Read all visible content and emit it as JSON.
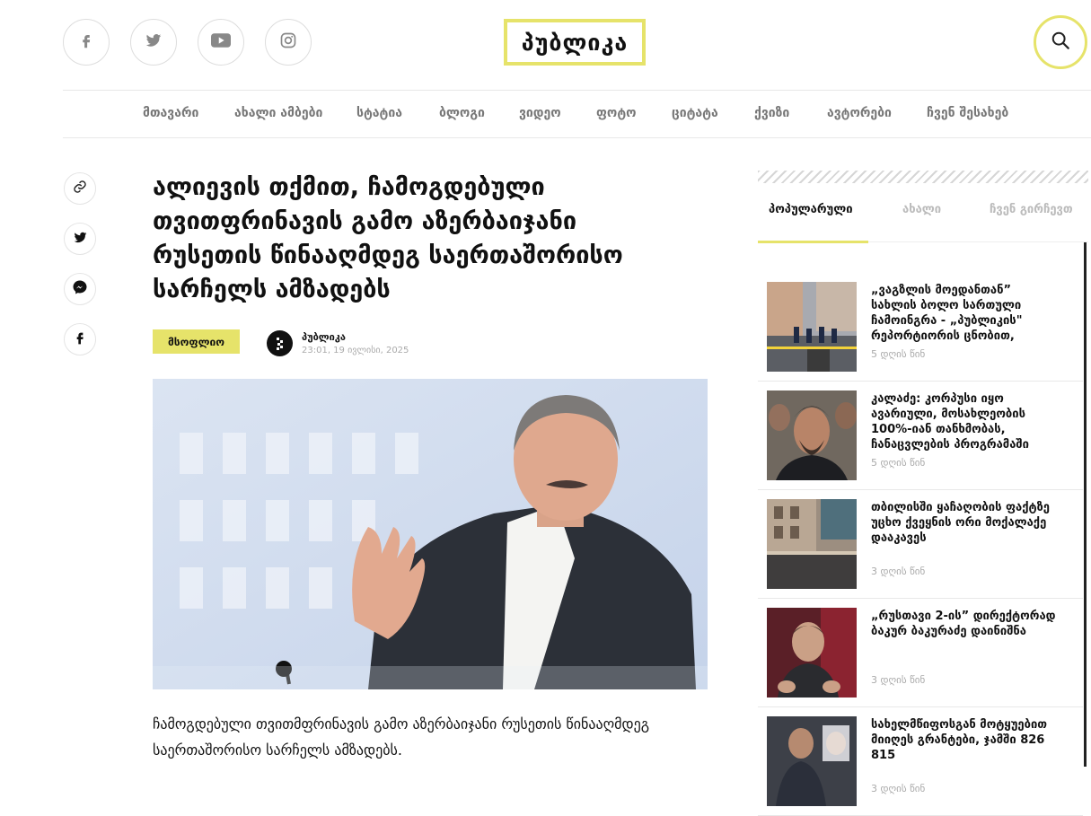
{
  "header": {
    "logo_text": "პუბლიკა",
    "social": [
      "facebook-icon",
      "twitter-icon",
      "youtube-icon",
      "instagram-icon"
    ],
    "search_icon": "search-icon",
    "accent_color": "#e6e36a"
  },
  "nav": {
    "items": [
      {
        "label": "მთავარი"
      },
      {
        "label": "ახალი ამბები"
      },
      {
        "label": "სტატია"
      },
      {
        "label": "ბლოგი"
      },
      {
        "label": "ვიდეო"
      },
      {
        "label": "ფოტო"
      },
      {
        "label": "ციტატა"
      },
      {
        "label": "ქვიზი"
      },
      {
        "label": "ავტორები"
      },
      {
        "label": "ჩვენ შესახებ"
      }
    ]
  },
  "share": [
    "link-icon",
    "twitter-icon",
    "messenger-icon",
    "facebook-icon"
  ],
  "article": {
    "title": "ალიევის თქმით, ჩამოგდებული თვითფრინავის გამო აზერბაიჯანი რუსეთის წინააღმდეგ საერთაშორისო სარჩელს ამზადებს",
    "category": "მსოფლიო",
    "author": "პუბლიკა",
    "date": "23:01, 19 ივლისი, 2025",
    "lead": "ჩამოგდებული თვითმფრინავის გამო აზერბაიჯანი რუსეთის წინააღმდეგ საერთაშორისო სარჩელს ამზადებს."
  },
  "sidebar": {
    "tabs": [
      {
        "label": "პოპულარული",
        "active": true
      },
      {
        "label": "ახალი",
        "active": false
      },
      {
        "label": "ჩვენ გირჩევთ",
        "active": false
      }
    ],
    "items": [
      {
        "title": "„ვაგზლის მოედანთან” სახლის ბოლო სართული ჩამოინგრა - „პუბლიკის\" რეპორტიორის ცნობით,",
        "time": "5 დღის წინ"
      },
      {
        "title": "კალაძე: კორპუსი იყო ავარიული, მოსახლეობის 100%-იან თანხმობას, ჩანაცვლების პროგრამაში",
        "time": "5 დღის წინ"
      },
      {
        "title": "თბილისში ყაჩაღობის ფაქტზე უცხო ქვეყნის ორი მოქალაქე დააკავეს",
        "time": "3 დღის წინ"
      },
      {
        "title": "„რუსთავი 2-ის” დირექტორად ბაკურ ბაკურაძე დაინიშნა",
        "time": "3 დღის წინ"
      },
      {
        "title": "სახელმწიფოსგან მოტყუებით მიიღეს გრანტები, ჯამში 826 815",
        "time": "3 დღის წინ"
      }
    ]
  }
}
